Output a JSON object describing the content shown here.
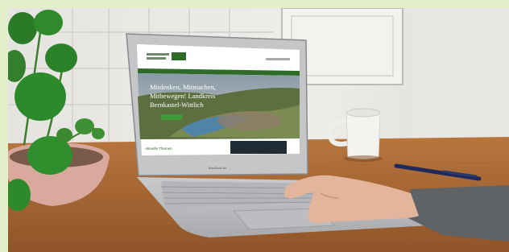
{
  "scene": {
    "laptop_screen": {
      "headline": "Mitdenken, Mitmachen, Mitbewegen! Landkreis Bernkastel-Wittlich",
      "headline_lines": [
        "Mitdenken, Mitmachen,",
        "Mitbewegen! Landkreis",
        "Bernkastel-Wittlich"
      ],
      "section_heading": "Aktuelle Themen",
      "brand_color": "#2e6b28"
    },
    "laptop_badge": "MacBook Air"
  }
}
